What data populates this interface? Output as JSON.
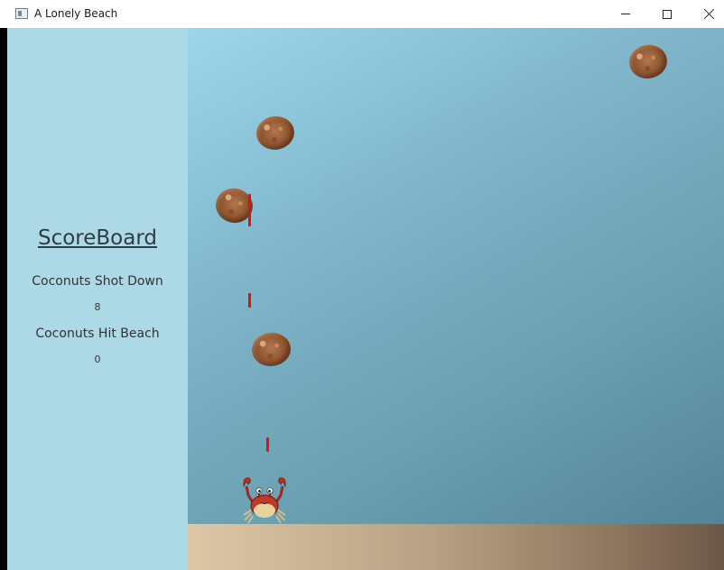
{
  "window": {
    "title": "A Lonely Beach",
    "icons": {
      "app": "app-window-icon",
      "minimize": "minimize-icon",
      "maximize": "maximize-icon",
      "close": "close-icon"
    }
  },
  "scoreboard": {
    "title": "ScoreBoard",
    "shot_label": "Coconuts Shot Down",
    "shot_value": "8",
    "hit_label": "Coconuts Hit Beach",
    "hit_value": "0"
  },
  "game": {
    "coconut_count": 4,
    "bullet_count": 4,
    "player": "crab",
    "colors": {
      "scoreboard_bg": "#add8e6",
      "sky_top": "#9cd6ea",
      "sky_bottom": "#507f92",
      "bullet": "#e01010",
      "sand_light": "#dec6a8",
      "sand_dark": "#6c5747"
    }
  }
}
